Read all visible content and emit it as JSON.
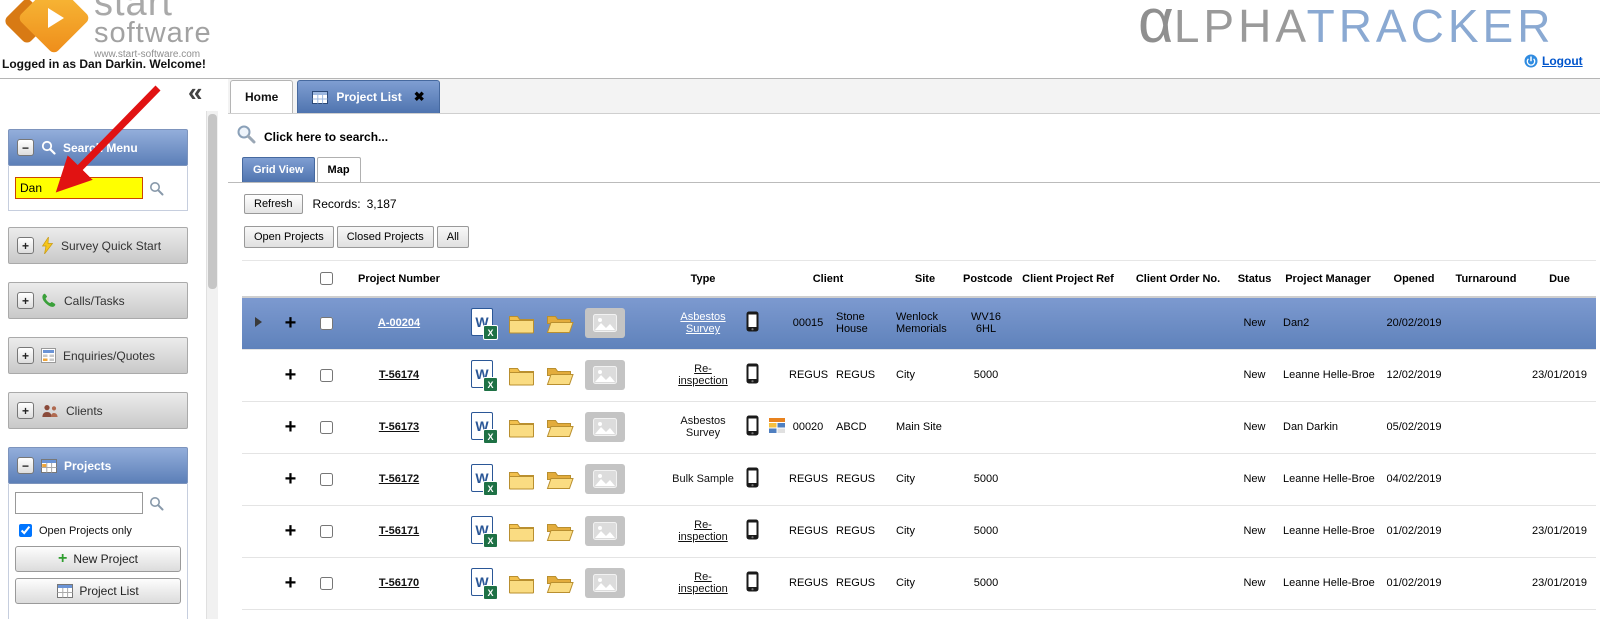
{
  "header": {
    "logo": {
      "line1": "start",
      "line2": "software",
      "website": "www.start-software.com"
    },
    "welcome": "Logged in as Dan Darkin. Welcome!",
    "app_logo": {
      "alpha": "α",
      "gray": "LPHA",
      "blue": "TRACKER"
    },
    "logout_label": "Logout"
  },
  "icons": {
    "plus": "+",
    "minus": "−",
    "close": "✖"
  },
  "tabs": [
    {
      "label": "Home",
      "active": false
    },
    {
      "label": "Project List",
      "active": true
    }
  ],
  "sidebar": {
    "collapse_icon": "«",
    "sections": [
      {
        "label": "Search Menu",
        "expanded": true
      },
      {
        "label": "Survey Quick Start",
        "expanded": false
      },
      {
        "label": "Calls/Tasks",
        "expanded": false
      },
      {
        "label": "Enquiries/Quotes",
        "expanded": false
      },
      {
        "label": "Clients",
        "expanded": false
      },
      {
        "label": "Projects",
        "expanded": true
      }
    ],
    "search_box": {
      "value": "Dan"
    },
    "projects_panel": {
      "search_value": "",
      "open_projects_only_label": "Open Projects only",
      "open_projects_only_checked": true,
      "new_project_label": "New Project",
      "project_list_label": "Project List"
    }
  },
  "toolbar": {
    "search_hint": "Click here to search...",
    "view_tabs": [
      {
        "label": "Grid View",
        "active": true
      },
      {
        "label": "Map",
        "active": false
      }
    ],
    "refresh_label": "Refresh",
    "records_label": "Records:",
    "records_value": "3,187",
    "filters": [
      "Open Projects",
      "Closed Projects",
      "All"
    ]
  },
  "table": {
    "columns": [
      "Project Number",
      "Type",
      "Client",
      "Site",
      "Postcode",
      "Client Project Ref",
      "Client Order No.",
      "Status",
      "Project Manager",
      "Opened",
      "Turnaround",
      "Due"
    ],
    "rows": [
      {
        "selected": true,
        "project_number": "A-00204",
        "type": "Asbestos Survey",
        "type_link": true,
        "has_client_icon": false,
        "client_code": "00015",
        "client_name": "Stone House",
        "site": "Wenlock Memorials",
        "postcode": "WV16 6HL",
        "client_project_ref": "",
        "client_order_no": "",
        "status": "New",
        "project_manager": "Dan2",
        "opened": "20/02/2019",
        "turnaround": "",
        "due": ""
      },
      {
        "selected": false,
        "project_number": "T-56174",
        "type": "Re-inspection",
        "type_link": true,
        "has_client_icon": false,
        "client_code": "REGUS",
        "client_name": "REGUS",
        "site": "City",
        "postcode": "5000",
        "client_project_ref": "",
        "client_order_no": "",
        "status": "New",
        "project_manager": "Leanne Helle-Broe",
        "opened": "12/02/2019",
        "turnaround": "",
        "due": "23/01/2019"
      },
      {
        "selected": false,
        "project_number": "T-56173",
        "type": "Asbestos Survey",
        "type_link": false,
        "has_client_icon": true,
        "client_code": "00020",
        "client_name": "ABCD",
        "site": "Main Site",
        "postcode": "",
        "client_project_ref": "",
        "client_order_no": "",
        "status": "New",
        "project_manager": "Dan Darkin",
        "opened": "05/02/2019",
        "turnaround": "",
        "due": ""
      },
      {
        "selected": false,
        "project_number": "T-56172",
        "type": "Bulk Sample",
        "type_link": false,
        "has_client_icon": false,
        "client_code": "REGUS",
        "client_name": "REGUS",
        "site": "City",
        "postcode": "5000",
        "client_project_ref": "",
        "client_order_no": "",
        "status": "New",
        "project_manager": "Leanne Helle-Broe",
        "opened": "04/02/2019",
        "turnaround": "",
        "due": ""
      },
      {
        "selected": false,
        "project_number": "T-56171",
        "type": "Re-inspection",
        "type_link": true,
        "has_client_icon": false,
        "client_code": "REGUS",
        "client_name": "REGUS",
        "site": "City",
        "postcode": "5000",
        "client_project_ref": "",
        "client_order_no": "",
        "status": "New",
        "project_manager": "Leanne Helle-Broe",
        "opened": "01/02/2019",
        "turnaround": "",
        "due": "23/01/2019"
      },
      {
        "selected": false,
        "project_number": "T-56170",
        "type": "Re-inspection",
        "type_link": true,
        "has_client_icon": false,
        "client_code": "REGUS",
        "client_name": "REGUS",
        "site": "City",
        "postcode": "5000",
        "client_project_ref": "",
        "client_order_no": "",
        "status": "New",
        "project_manager": "Leanne Helle-Broe",
        "opened": "01/02/2019",
        "turnaround": "",
        "due": "23/01/2019"
      }
    ]
  },
  "colors": {
    "accent_blue": "#5c7fb8",
    "selected_row_blue": "#6e8fc9",
    "highlight_yellow": "#ffff00",
    "annotation_red": "#e11212",
    "logo_orange": "#ee8c1a",
    "logo_blue": "#8aa9d2",
    "logo_gray": "#9a9a9a"
  }
}
